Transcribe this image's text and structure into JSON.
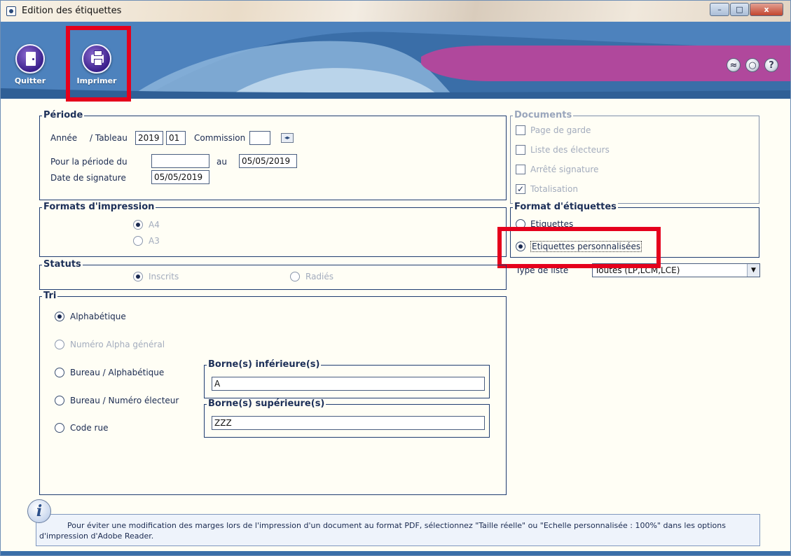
{
  "window": {
    "title": "Edition des étiquettes",
    "controls": {
      "minimize": "–",
      "maximize": "□",
      "close": "x"
    }
  },
  "toolbar": {
    "quit_label": "Quitter",
    "print_label": "Imprimer",
    "right_icons": [
      "graduation-icon",
      "support-icon",
      "help-icon"
    ],
    "help_glyph": "?"
  },
  "periode": {
    "title": "Période",
    "annee_label": "Année",
    "tableau_label": "/ Tableau",
    "annee_value": "2019",
    "tableau_value": "01",
    "commission_label": "Commission",
    "commission_value": "",
    "spin_glyph": "◂▸",
    "periode_du_label": "Pour la période du",
    "periode_du_value": "",
    "au_label": "au",
    "au_value": "05/05/2019",
    "signature_label": "Date de signature",
    "signature_value": "05/05/2019"
  },
  "documents": {
    "title": "Documents",
    "items": [
      {
        "label": "Page de garde",
        "checked": false
      },
      {
        "label": "Liste des électeurs",
        "checked": false
      },
      {
        "label": "Arrêté signature",
        "checked": false
      },
      {
        "label": "Totalisation",
        "checked": true
      }
    ],
    "check_glyph": "✓"
  },
  "formats": {
    "title": "Formats d'impression",
    "options": [
      "A4",
      "A3"
    ],
    "selected": "A4"
  },
  "format_etiquettes": {
    "title": "Format d'étiquettes",
    "options": [
      "Etiquettes",
      "Etiquettes personnalisées"
    ],
    "selected": "Etiquettes personnalisées"
  },
  "type_liste": {
    "label": "Type de liste",
    "value": "Toutes (LP,LCM,LCE)",
    "arrow": "▼"
  },
  "statuts": {
    "title": "Statuts",
    "options": [
      "Inscrits",
      "Radiés"
    ],
    "selected": "Inscrits"
  },
  "tri": {
    "title": "Tri",
    "options": [
      "Alphabétique",
      "Numéro Alpha général",
      "Bureau / Alphabétique",
      "Bureau / Numéro électeur",
      "Code rue"
    ],
    "selected": "Alphabétique",
    "borne_inf_title": "Borne(s) inférieure(s)",
    "borne_inf_value": "A",
    "borne_sup_title": "Borne(s) supérieure(s)",
    "borne_sup_value": "ZZZ"
  },
  "info": {
    "glyph": "i",
    "text": "Pour éviter une modification des marges lors de l'impression d'un document au format PDF, sélectionnez \"Taille réelle\" ou \"Echelle personnalisée : 100%\" dans les options d'impression d'Adobe Reader."
  },
  "colors": {
    "header_blue": "#3a6ea8",
    "header_magenta": "#b0489c",
    "highlight_red": "#e5001c",
    "panel_bg": "#fffef5",
    "frame_navy": "#1f3c70"
  }
}
